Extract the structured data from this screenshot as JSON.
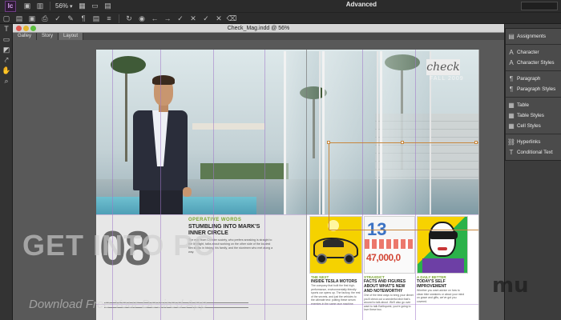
{
  "app": {
    "logo": "Ic",
    "document_title": "Check_Mag.indd @ 56%"
  },
  "toolbar": {
    "zoom": "56%",
    "workspace": "Advanced"
  },
  "doc_tabs": [
    "Galley",
    "Story",
    "Layout"
  ],
  "panels": [
    {
      "icon": "assignments-icon",
      "glyph": "▤",
      "label": "Assignments"
    },
    {
      "icon": "character-icon",
      "glyph": "A",
      "label": "Character"
    },
    {
      "icon": "character-styles-icon",
      "glyph": "A",
      "label": "Character Styles"
    },
    {
      "icon": "paragraph-icon",
      "glyph": "¶",
      "label": "Paragraph"
    },
    {
      "icon": "paragraph-styles-icon",
      "glyph": "¶",
      "label": "Paragraph Styles"
    },
    {
      "icon": "table-icon",
      "glyph": "▦",
      "label": "Table"
    },
    {
      "icon": "table-styles-icon",
      "glyph": "▦",
      "label": "Table Styles"
    },
    {
      "icon": "cell-styles-icon",
      "glyph": "▦",
      "label": "Cell Styles"
    },
    {
      "icon": "hyperlinks-icon",
      "glyph": "⛓",
      "label": "Hyperlinks"
    },
    {
      "icon": "conditional-text-icon",
      "glyph": "T",
      "label": "Conditional Text"
    }
  ],
  "magazine": {
    "logo": "check",
    "issue": "FALL 2009",
    "big_number": "08",
    "kicker": "OPERATIVE WORDS",
    "headline": "STUMBLING INTO MARK'S INNER CIRCLE",
    "body": "The man from Chester society, who prefers sneaking is straight to the limelight, talks about working on the other side of the loudest film studio in history, his family, and the stuntmen who met along a way.",
    "stats_big": "13",
    "stats_number": "47,000,0",
    "columns": [
      {
        "kicker": "THE NEXT",
        "headline": "INSIDE TESLA MOTORS",
        "body": "The company that built the first high-performance, environmentally friendly sports car opens up. The factory, the rest of the secrets, and just the vehicles to the ultimate test: putting these serum enemies in the same race machine."
      },
      {
        "kicker": "STRAXDICT",
        "headline": "FACTS AND FIGURES ABOUT WHAT'S NEW AND NOTEWORTHY",
        "body": "One of the best ways to bring your dinner you'll check out a wonderful dish that's around to talk about. We'll also go over want to talk Earthquest, you're going to love these two."
      },
      {
        "kicker": "A DAILY BETTER",
        "headline": "TODAY'S SELF IMPROVEMENT",
        "body": "Whether you want advice on how to clean bike sneakers or about your mind on grace and gifts, we've got you covered."
      }
    ]
  },
  "overlay": {
    "watermark": "GET INTO PC",
    "subtitle": "Download Free Your Desired App",
    "brand": "mu"
  }
}
